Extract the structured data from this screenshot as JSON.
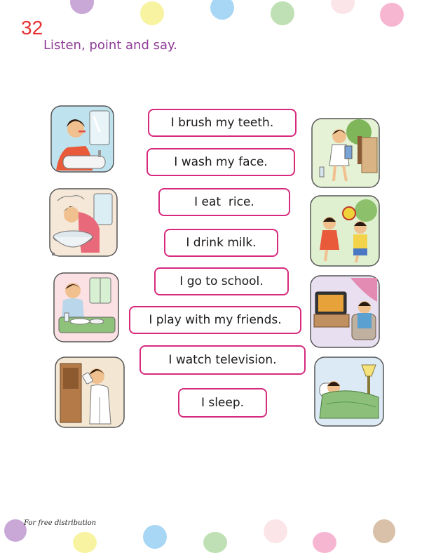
{
  "page": {
    "number": "32",
    "instruction": "Listen, point and say."
  },
  "sentences": [
    "I brush my teeth.",
    "I wash my face.",
    "I eat  rice.",
    "I drink milk.",
    "I go to school.",
    "I play with my friends.",
    "I watch television.",
    "I sleep."
  ],
  "pictures": {
    "left": [
      "brushing-teeth",
      "washing-face",
      "eating-rice",
      "drinking-milk"
    ],
    "right": [
      "going-to-school",
      "playing-with-friends",
      "watching-television",
      "sleeping"
    ]
  },
  "footer": {
    "text": "For free distribution"
  },
  "colors": {
    "accent_border": "#d62a7e",
    "page_number": "#e63232",
    "instruction": "#8e3b97",
    "dots": [
      "#c9a8d8",
      "#f7f3a1",
      "#a8d6f5",
      "#bfe0b4",
      "#fbe5e8",
      "#f6b6d2",
      "#d9c0a8"
    ]
  }
}
